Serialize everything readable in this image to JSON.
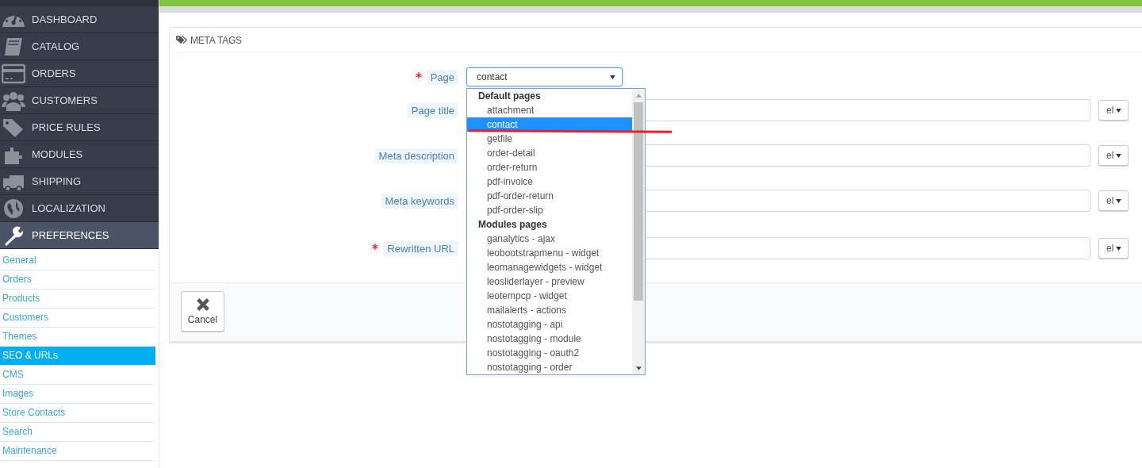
{
  "sidebar": {
    "menu": [
      {
        "label": "DASHBOARD",
        "selected": false
      },
      {
        "label": "CATALOG",
        "selected": false
      },
      {
        "label": "ORDERS",
        "selected": false
      },
      {
        "label": "CUSTOMERS",
        "selected": false
      },
      {
        "label": "PRICE RULES",
        "selected": false
      },
      {
        "label": "MODULES",
        "selected": false
      },
      {
        "label": "SHIPPING",
        "selected": false
      },
      {
        "label": "LOCALIZATION",
        "selected": false
      },
      {
        "label": "PREFERENCES",
        "selected": true
      }
    ],
    "submenu": [
      {
        "label": "General",
        "selected": false
      },
      {
        "label": "Orders",
        "selected": false
      },
      {
        "label": "Products",
        "selected": false
      },
      {
        "label": "Customers",
        "selected": false
      },
      {
        "label": "Themes",
        "selected": false
      },
      {
        "label": "SEO & URLs",
        "selected": true
      },
      {
        "label": "CMS",
        "selected": false
      },
      {
        "label": "Images",
        "selected": false
      },
      {
        "label": "Store Contacts",
        "selected": false
      },
      {
        "label": "Search",
        "selected": false
      },
      {
        "label": "Maintenance",
        "selected": false
      }
    ]
  },
  "panel": {
    "title": "META TAGS",
    "fields": [
      {
        "kind": "select",
        "label": "Page",
        "required": true,
        "value": "contact"
      },
      {
        "kind": "text",
        "label": "Page title",
        "required": false,
        "lang": "el"
      },
      {
        "kind": "text",
        "label": "Meta description",
        "required": false,
        "lang": "el"
      },
      {
        "kind": "text",
        "label": "Meta keywords",
        "required": false,
        "lang": "el"
      },
      {
        "kind": "text",
        "label": "Rewritten URL",
        "required": true,
        "lang": "el"
      }
    ],
    "dropdown": {
      "groups": [
        {
          "label": "Default pages",
          "options": [
            {
              "label": "attachment",
              "selected": false
            },
            {
              "label": "contact",
              "selected": true
            },
            {
              "label": "getfile",
              "selected": false
            },
            {
              "label": "order-detail",
              "selected": false
            },
            {
              "label": "order-return",
              "selected": false
            },
            {
              "label": "pdf-invoice",
              "selected": false
            },
            {
              "label": "pdf-order-return",
              "selected": false
            },
            {
              "label": "pdf-order-slip",
              "selected": false
            }
          ]
        },
        {
          "label": "Modules pages",
          "options": [
            {
              "label": "ganalytics - ajax",
              "selected": false
            },
            {
              "label": "leobootstrapmenu - widget",
              "selected": false
            },
            {
              "label": "leomanagewidgets - widget",
              "selected": false
            },
            {
              "label": "leosliderlayer - preview",
              "selected": false
            },
            {
              "label": "leotempcp - widget",
              "selected": false
            },
            {
              "label": "mailalerts - actions",
              "selected": false
            },
            {
              "label": "nostotagging - api",
              "selected": false
            },
            {
              "label": "nostotagging - module",
              "selected": false
            },
            {
              "label": "nostotagging - oauth2",
              "selected": false
            },
            {
              "label": "nostotagging - order",
              "selected": false
            }
          ]
        }
      ]
    },
    "cancel": "Cancel"
  }
}
